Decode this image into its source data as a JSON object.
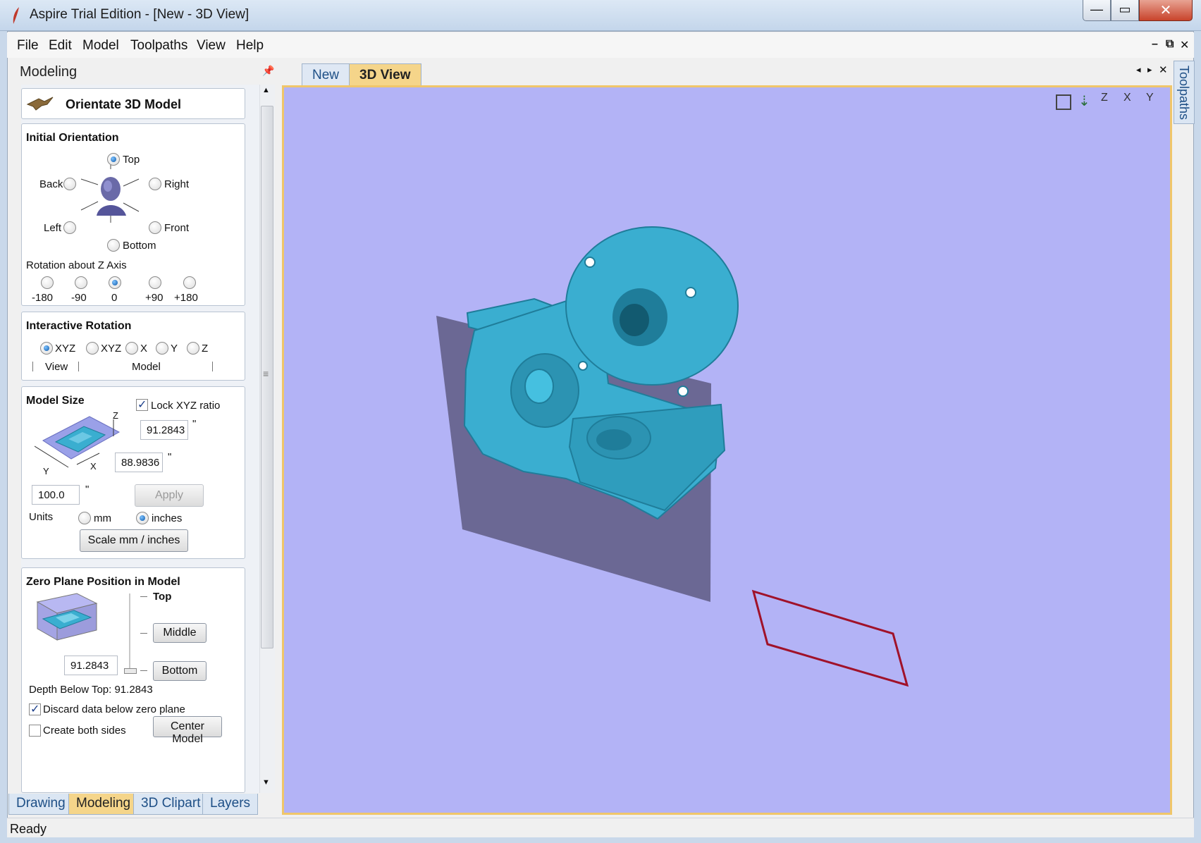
{
  "window": {
    "title": "Aspire Trial Edition - [New - 3D View]"
  },
  "menu": [
    "File",
    "Edit",
    "Model",
    "Toolpaths",
    "View",
    "Help"
  ],
  "mdi_controls": {
    "minimize": "–",
    "restore": "⧉",
    "close": "✕"
  },
  "panel": {
    "title": "Modeling",
    "header": "Orientate 3D Model",
    "initial_orientation": {
      "title": "Initial Orientation",
      "options": {
        "top": "Top",
        "back": "Back",
        "right": "Right",
        "left": "Left",
        "front": "Front",
        "bottom": "Bottom"
      },
      "selected": "Top",
      "rotation_label": "Rotation about Z Axis",
      "rotation_options": [
        "-180",
        "-90",
        "0",
        "+90",
        "+180"
      ],
      "rotation_selected": "0"
    },
    "interactive_rotation": {
      "title": "Interactive Rotation",
      "options": [
        "XYZ",
        "XYZ",
        "X",
        "Y",
        "Z"
      ],
      "selected_index": 0,
      "view_label": "View",
      "model_label": "Model"
    },
    "model_size": {
      "title": "Model Size",
      "lock_label": "Lock XYZ ratio",
      "lock_checked": true,
      "z_value": "91.2843",
      "x_value": "88.9836",
      "y_value": "100.0",
      "unit_mark": "\"",
      "apply_label": "Apply",
      "units_label": "Units",
      "unit_mm": "mm",
      "unit_inches": "inches",
      "units_selected": "inches",
      "scale_label": "Scale mm / inches",
      "axis_z": "Z",
      "axis_x": "X",
      "axis_y": "Y"
    },
    "zero_plane": {
      "title": "Zero Plane Position in Model",
      "top_label": "Top",
      "middle_label": "Middle",
      "bottom_label": "Bottom",
      "position_value": "91.2843",
      "depth_text": "Depth Below Top:  91.2843",
      "discard_label": "Discard data below zero plane",
      "discard_checked": true,
      "both_sides_label": "Create both sides",
      "both_sides_checked": false,
      "center_label": "Center Model"
    }
  },
  "bottom_tabs": [
    "Drawing",
    "Modeling",
    "3D Clipart",
    "Layers"
  ],
  "active_bottom_tab": "Modeling",
  "doc_tabs": [
    "New",
    "3D View"
  ],
  "active_doc_tab": "3D View",
  "side_tab": "Toolpaths",
  "view_toolbar": [
    "zoom-extents-icon",
    "iso-view-icon",
    "z-view-icon",
    "x-view-icon",
    "y-view-icon"
  ],
  "view_axes": {
    "z": "Z",
    "x": "X",
    "y": "Y"
  },
  "status": "Ready",
  "colors": {
    "viewport_bg": "#b3b3f6",
    "model": "#3aaed0",
    "zero_plane": "#6b6894",
    "material_outline": "#a0122a",
    "active_tab": "#f5d58a"
  }
}
